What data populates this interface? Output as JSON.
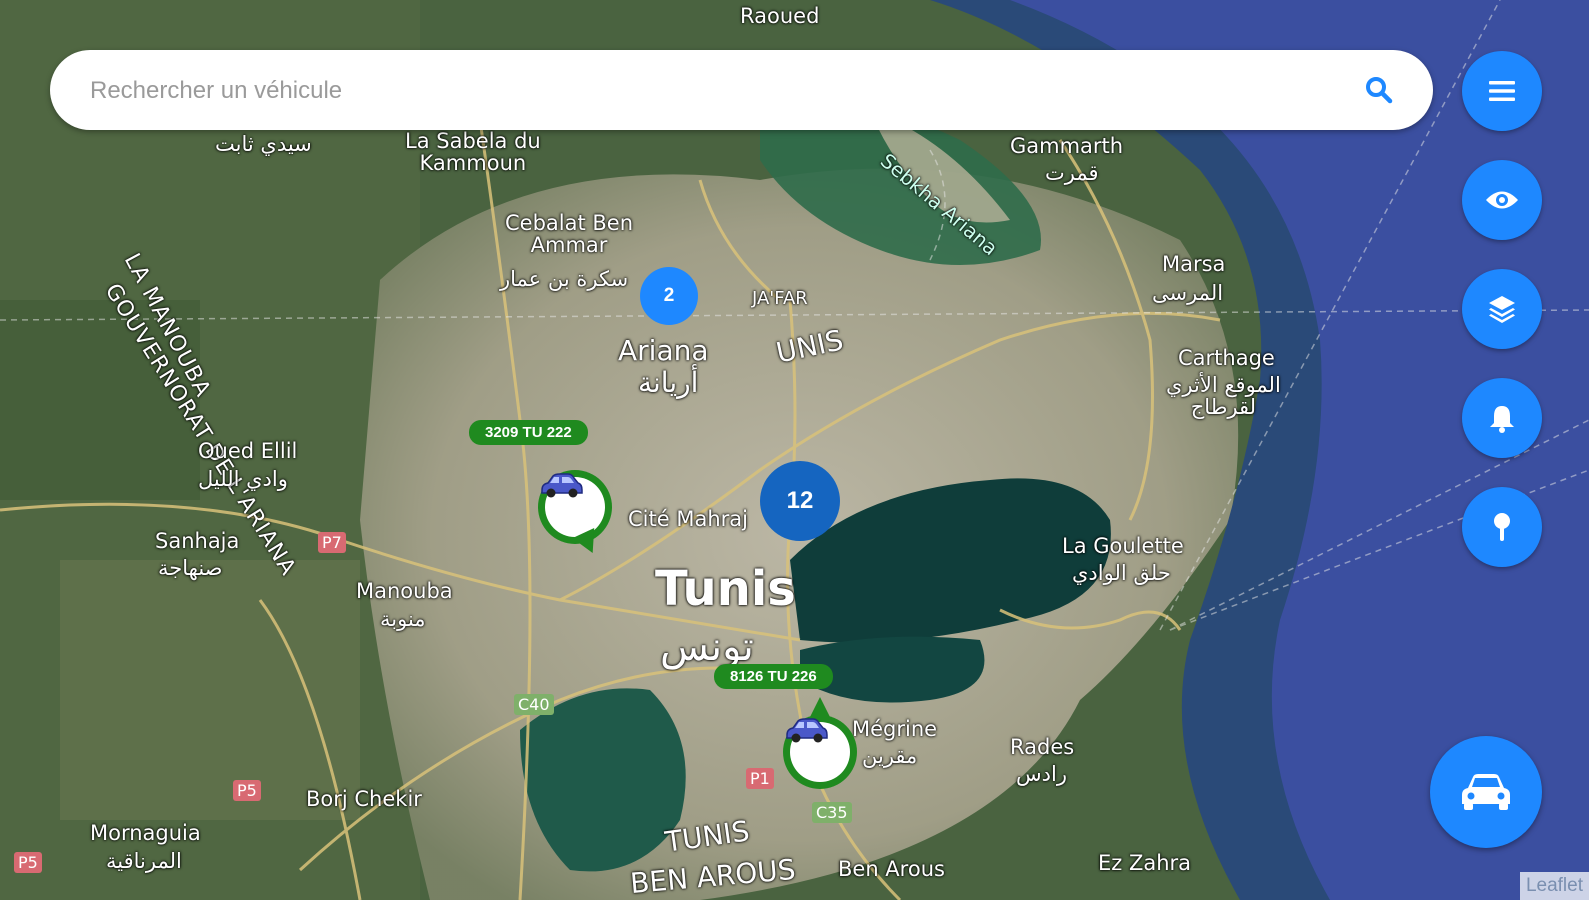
{
  "search": {
    "placeholder": "Rechercher un véhicule"
  },
  "map_labels": {
    "raoued": "Raoued",
    "gammarth": "Gammarth",
    "gammarth_ar": "قمرت",
    "sabela": "La Sabela du\nKammoun",
    "sidi_thabet_ar": "سيدي ثابت",
    "cebalat": "Cebalat Ben\nAmmar",
    "cebalat_ar": "سكرة بن عمار",
    "gouvernorat_ariana": "GOUVERNORAT DE L'ARIANA",
    "la_manouba": "LA MANOUBA",
    "ariana": "Ariana",
    "ariana_ar": "أريانة",
    "jafar": "JA'FAR",
    "tunis_partial": "UNIS",
    "sebkha_ariana": "Sebkha Ariana",
    "marsa": "Marsa",
    "marsa_ar": "المرسى",
    "carthage": "Carthage",
    "carthage_ar": "الموقع الأثري\nلقرطاج",
    "oued_ellil": "Oued Ellil",
    "oued_ellil_ar": "وادي الليل",
    "cite_mahrajene": "Cité Mahraj",
    "sanhaja": "Sanhaja",
    "sanhaja_ar": "صنهاجة",
    "manouba": "Manouba",
    "manouba_ar": "منوبة",
    "tunis": "Tunis",
    "tunis_ar": "تونس",
    "la_goulette": "La Goulette",
    "la_goulette_ar": "حلق الوادي",
    "megrine": "Mégrine",
    "megrine_ar": "مقرين",
    "rades": "Rades",
    "rades_ar": "رادس",
    "borj_chekir": "Borj Chekir",
    "mornaguia": "Mornaguia",
    "mornaguia_ar": "المرناقية",
    "tunis_bottom": "TUNIS",
    "ben_arous_gov": "BEN AROUS",
    "ben_arous": "Ben Arous",
    "ez_zahra": "Ez Zahra"
  },
  "road_shields": {
    "p7": "P7",
    "c40": "C40",
    "p5a": "P5",
    "p5b": "P5",
    "p1": "P1",
    "c35": "C35"
  },
  "clusters": [
    {
      "count": "2"
    },
    {
      "count": "12"
    }
  ],
  "vehicles": [
    {
      "plate": "3209 TU 222"
    },
    {
      "plate": "8126 TU 226"
    }
  ],
  "colors": {
    "accent": "#1e88ff",
    "cluster_small": "#1e88ff",
    "cluster_large": "#1565c0",
    "vehicle_green": "#1f8a1f"
  },
  "fab_buttons": [
    {
      "icon": "menu-icon"
    },
    {
      "icon": "eye-icon"
    },
    {
      "icon": "layers-icon"
    },
    {
      "icon": "bell-icon"
    },
    {
      "icon": "map-pin-icon"
    }
  ],
  "main_fab": {
    "icon": "car-icon"
  },
  "attribution": "Leaflet"
}
